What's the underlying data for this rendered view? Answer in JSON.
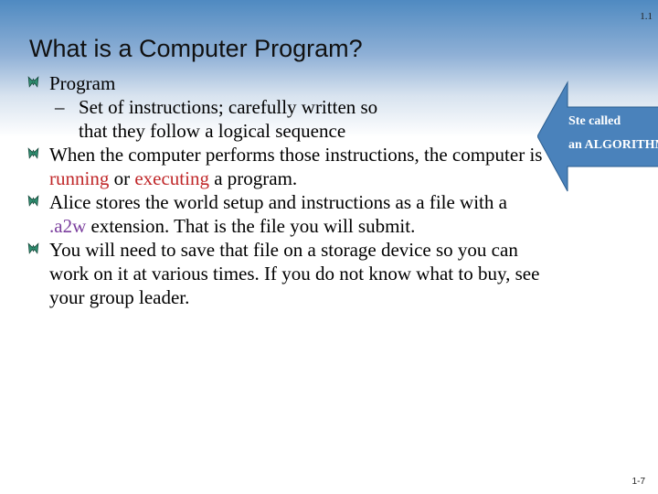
{
  "slide_number_top": "1.1",
  "title": "What is a Computer Program?",
  "bullets": [
    {
      "text": "Program",
      "sub": [
        "Set of instructions; carefully written so",
        "that they follow a logical sequence"
      ]
    },
    {
      "line1": "When the computer performs those instructions, the computer is",
      "line2_parts": [
        "running",
        " or ",
        "executing",
        " a program."
      ]
    },
    {
      "line1": "Alice stores the world setup and instructions as a file with a",
      "line2_parts": [
        ".a2w",
        " extension.  That is the file you will submit."
      ]
    },
    {
      "lines": [
        "You will need to save that file on a storage device so you can",
        "work on it at various times.  If you do not know what to buy, see",
        "your group leader."
      ]
    }
  ],
  "callout": {
    "line1": "Ste called",
    "line2": "an ALGORITHM",
    "color": "#4a82bb"
  },
  "footer_page": "1-7"
}
